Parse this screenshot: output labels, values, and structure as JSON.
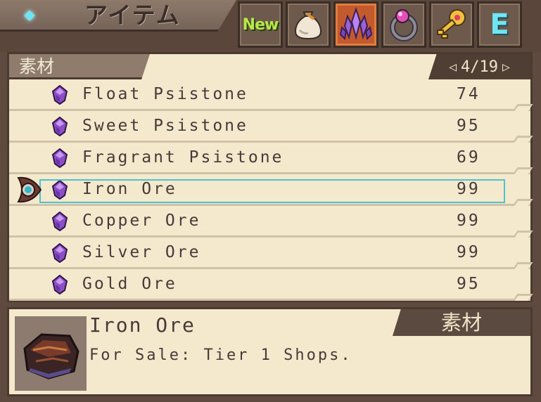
{
  "header": {
    "title": "アイテム",
    "tabs": [
      {
        "id": "new",
        "label": "New",
        "icon": "new-label-icon"
      },
      {
        "id": "bag",
        "icon": "item-bag-icon"
      },
      {
        "id": "materials",
        "icon": "purple-crystal-icon",
        "active": true
      },
      {
        "id": "accessories",
        "icon": "ring-icon"
      },
      {
        "id": "key-items",
        "icon": "key-icon"
      },
      {
        "id": "equip",
        "label": "E",
        "icon": "equip-letter-icon"
      }
    ]
  },
  "list": {
    "category": "素材",
    "page": "4/19",
    "selected_index": 3,
    "items": [
      {
        "name": "Float Psistone",
        "qty": "74",
        "icon": "psistone-gem-icon"
      },
      {
        "name": "Sweet Psistone",
        "qty": "95",
        "icon": "psistone-gem-icon"
      },
      {
        "name": "Fragrant Psistone",
        "qty": "69",
        "icon": "psistone-gem-icon"
      },
      {
        "name": "Iron Ore",
        "qty": "99",
        "icon": "psistone-gem-icon"
      },
      {
        "name": "Copper Ore",
        "qty": "99",
        "icon": "psistone-gem-icon"
      },
      {
        "name": "Silver Ore",
        "qty": "99",
        "icon": "psistone-gem-icon"
      },
      {
        "name": "Gold Ore",
        "qty": "95",
        "icon": "psistone-gem-icon"
      }
    ]
  },
  "detail": {
    "name": "Iron Ore",
    "description": "For Sale: Tier 1 Shops.",
    "category": "素材",
    "icon": "iron-ore-icon"
  },
  "colors": {
    "panel_bg": "#f4e9cc",
    "frame": "#5b463c",
    "selection": "#4fc2cf",
    "active_tab": "#c35a2e"
  }
}
